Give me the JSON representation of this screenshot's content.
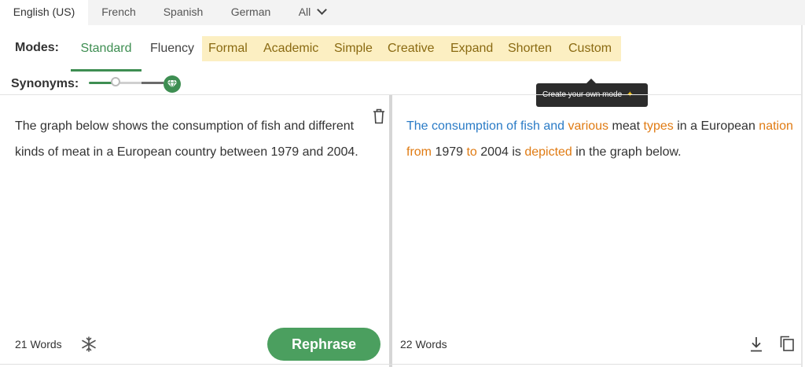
{
  "languages": {
    "tabs": [
      {
        "label": "English (US)"
      },
      {
        "label": "French"
      },
      {
        "label": "Spanish"
      },
      {
        "label": "German"
      },
      {
        "label": "All"
      }
    ],
    "active_index": 0
  },
  "modes": {
    "label": "Modes:",
    "items": [
      {
        "label": "Standard"
      },
      {
        "label": "Fluency"
      }
    ],
    "premium_items": [
      {
        "label": "Formal"
      },
      {
        "label": "Academic"
      },
      {
        "label": "Simple"
      },
      {
        "label": "Creative"
      },
      {
        "label": "Expand"
      },
      {
        "label": "Shorten"
      },
      {
        "label": "Custom"
      }
    ],
    "active": "Standard",
    "tooltip": "Create your own mode",
    "premium_color": "#fcefc2",
    "accent": "#3e8e52"
  },
  "synonyms": {
    "label": "Synonyms:",
    "level": 0.33
  },
  "input": {
    "text": "The graph below shows the consumption of fish and different kinds of meat in a European country between 1979 and 2004.",
    "word_count": "21 Words",
    "action_label": "Rephrase"
  },
  "output": {
    "segments": [
      {
        "t": "The consumption of fish and",
        "c": "syn"
      },
      {
        "t": " ",
        "c": ""
      },
      {
        "t": "various",
        "c": "chg"
      },
      {
        "t": " meat ",
        "c": ""
      },
      {
        "t": "types",
        "c": "chg"
      },
      {
        "t": " in a European ",
        "c": ""
      },
      {
        "t": "nation from",
        "c": "chg"
      },
      {
        "t": " 1979 ",
        "c": ""
      },
      {
        "t": "to",
        "c": "chg"
      },
      {
        "t": " 2004 is ",
        "c": ""
      },
      {
        "t": "depicted",
        "c": "chg"
      },
      {
        "t": " in the graph below.",
        "c": ""
      }
    ],
    "word_count": "22 Words",
    "colors": {
      "synonym": "#2a7bc6",
      "changed": "#e07b13"
    }
  }
}
